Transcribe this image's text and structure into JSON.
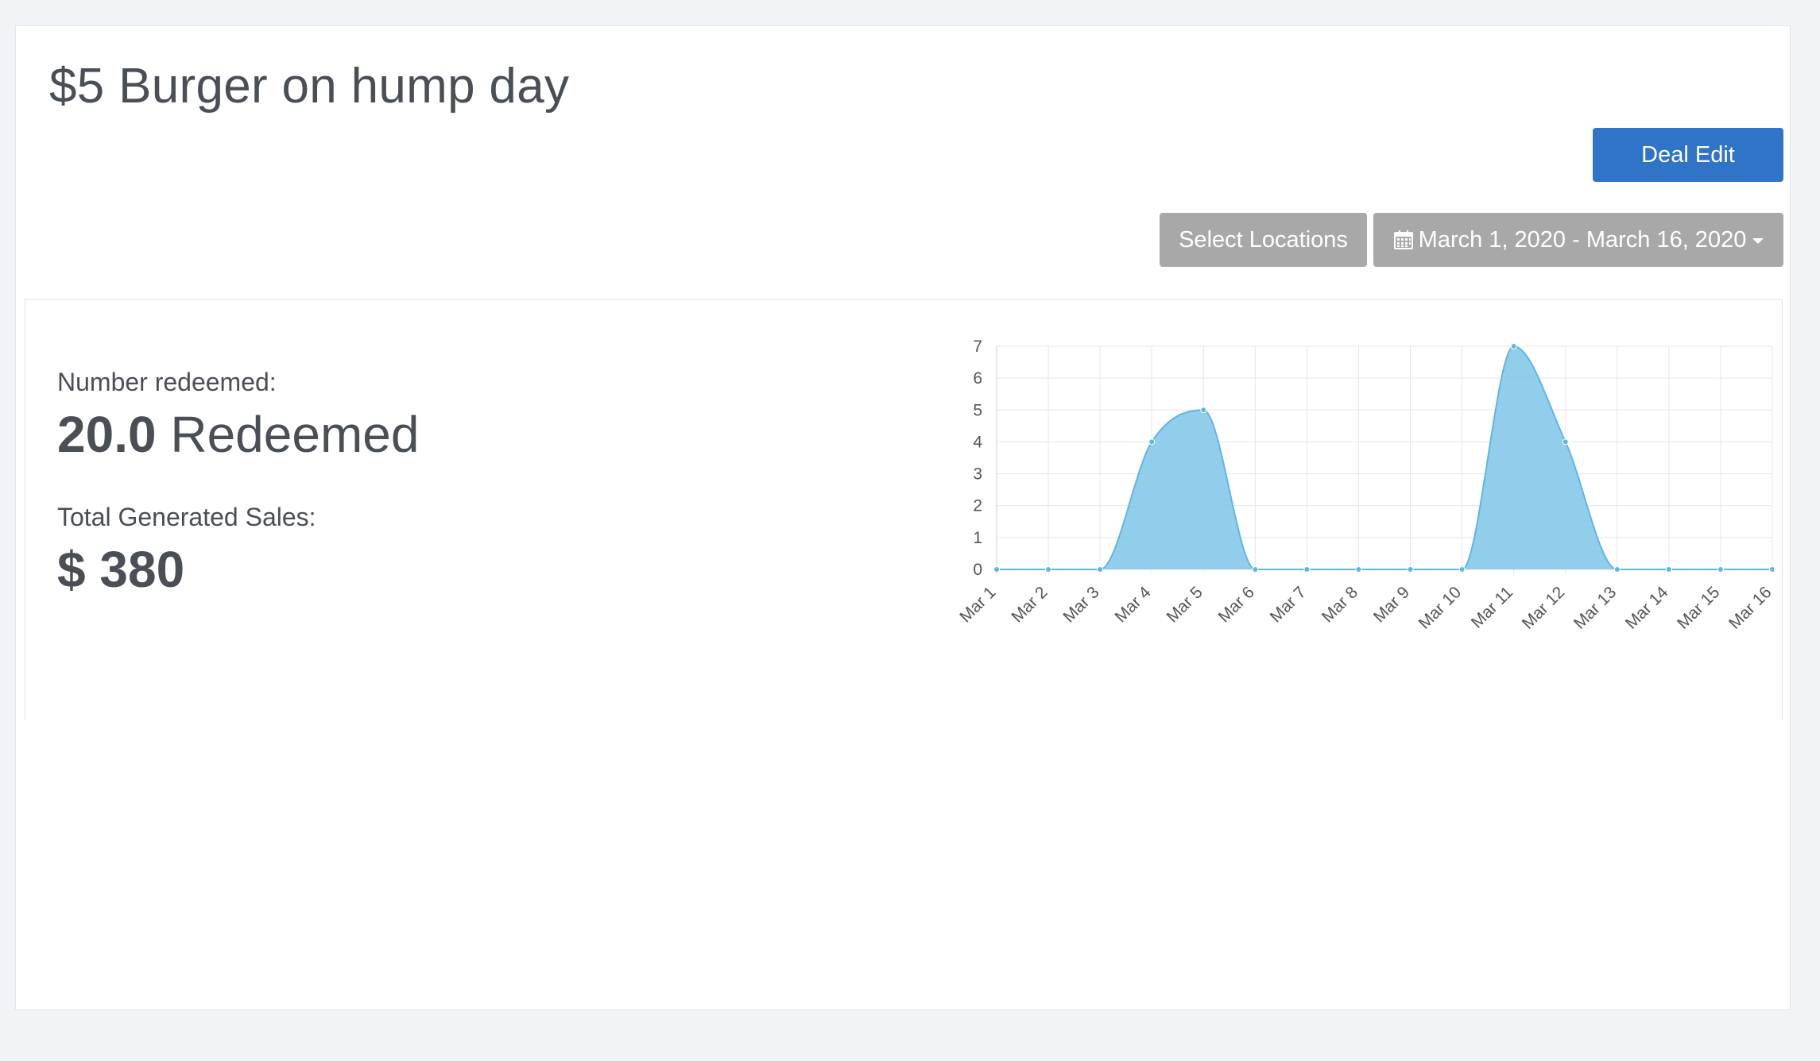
{
  "page": {
    "title": "$5 Burger on hump day"
  },
  "toolbar": {
    "deal_edit_label": "Deal Edit",
    "select_locations_label": "Select Locations",
    "date_range_label": "March 1, 2020 - March 16, 2020",
    "date_range_icon": "calendar-icon",
    "dropdown_icon": "caret-down-icon",
    "colors": {
      "primary": "#2f74c6",
      "secondary": "#a8a8a8"
    }
  },
  "stats": {
    "redeemed_label": "Number redeemed:",
    "redeemed_value": "20.0",
    "redeemed_unit": "Redeemed",
    "sales_label": "Total Generated Sales:",
    "sales_value": "$ 380"
  },
  "chart_data": {
    "type": "area",
    "categories": [
      "Mar 1",
      "Mar 2",
      "Mar 3",
      "Mar 4",
      "Mar 5",
      "Mar 6",
      "Mar 7",
      "Mar 8",
      "Mar 9",
      "Mar 10",
      "Mar 11",
      "Mar 12",
      "Mar 13",
      "Mar 14",
      "Mar 15",
      "Mar 16"
    ],
    "series": [
      {
        "values": [
          0,
          0,
          0,
          4,
          5,
          0,
          0,
          0,
          0,
          0,
          7,
          4,
          0,
          0,
          0,
          0
        ],
        "color": "#7ec5e8"
      }
    ],
    "yticks": [
      0,
      1,
      2,
      3,
      4,
      5,
      6,
      7
    ],
    "ylim": [
      0,
      7
    ],
    "grid": true,
    "legend": false
  }
}
